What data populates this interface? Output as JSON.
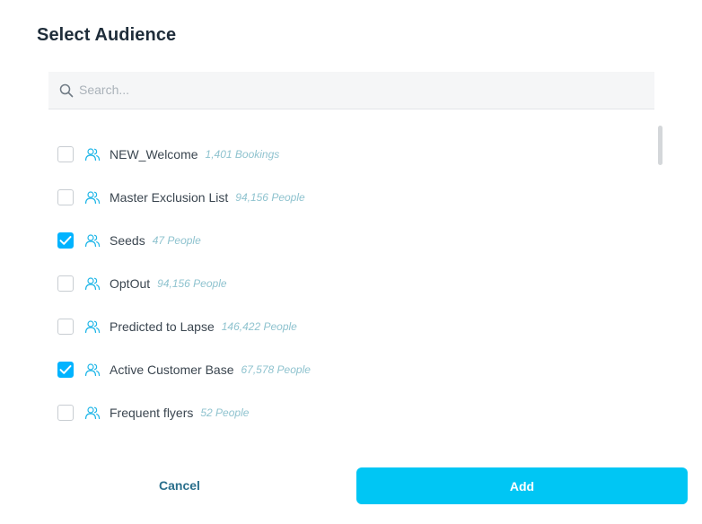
{
  "dialog": {
    "title": "Select Audience"
  },
  "search": {
    "placeholder": "Search...",
    "value": ""
  },
  "audiences": [
    {
      "name": "NEW_Welcome",
      "count": "1,401 Bookings",
      "checked": false
    },
    {
      "name": "Master Exclusion List",
      "count": "94,156 People",
      "checked": false
    },
    {
      "name": "Seeds",
      "count": "47 People",
      "checked": true
    },
    {
      "name": "OptOut",
      "count": "94,156 People",
      "checked": false
    },
    {
      "name": "Predicted to Lapse",
      "count": "146,422 People",
      "checked": false
    },
    {
      "name": "Active Customer Base",
      "count": "67,578 People",
      "checked": true
    },
    {
      "name": "Frequent flyers",
      "count": "52 People",
      "checked": false
    }
  ],
  "actions": {
    "cancel_label": "Cancel",
    "add_label": "Add"
  },
  "colors": {
    "accent": "#00c6f4",
    "checkbox_checked": "#00b3ff",
    "count_text": "#8fc3cf",
    "cancel_text": "#2a6f8c"
  },
  "icons": {
    "search": "search-icon",
    "audience": "people-icon",
    "checkmark": "check-icon"
  }
}
